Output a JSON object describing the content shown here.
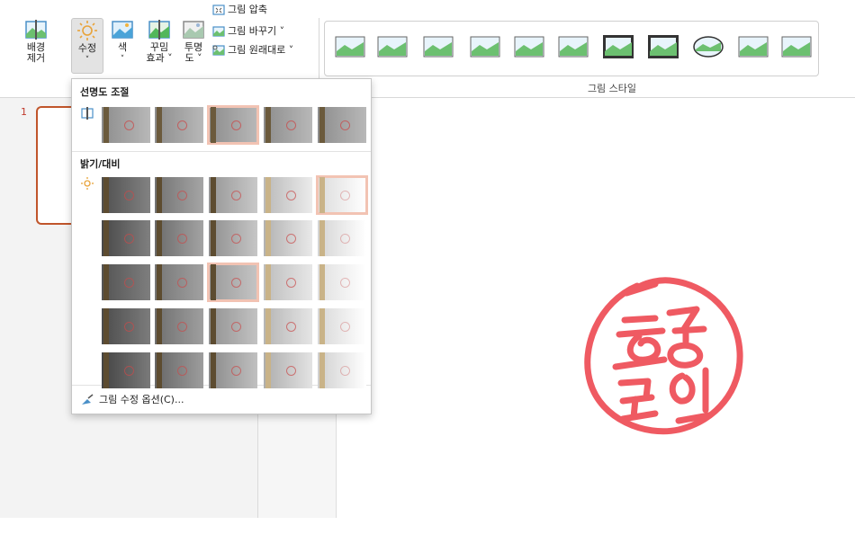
{
  "ribbon": {
    "buttons": {
      "remove_bg": "배경\n제거",
      "corrections": "수정",
      "color": "색",
      "artistic": "꾸밈\n효과 ˅",
      "transparency": "투명\n도 ˅"
    },
    "small_items": {
      "compress": "그림 압축",
      "change": "그림 바꾸기 ˅",
      "reset": "그림 원래대로  ˅"
    },
    "styles_group_label": "그림 스타일"
  },
  "dropdown": {
    "sharpen_header": "선명도 조절",
    "brightness_header": "밝기/대비",
    "options_label": "그림 수정 옵션(C)...",
    "sharpen_selected_index": 2,
    "brightness_selected": [
      [
        0,
        4
      ],
      [
        2,
        2
      ]
    ]
  },
  "slides": {
    "number": "1"
  },
  "colors": {
    "accent": "#c0552b",
    "stamp": "#ef5a62"
  }
}
